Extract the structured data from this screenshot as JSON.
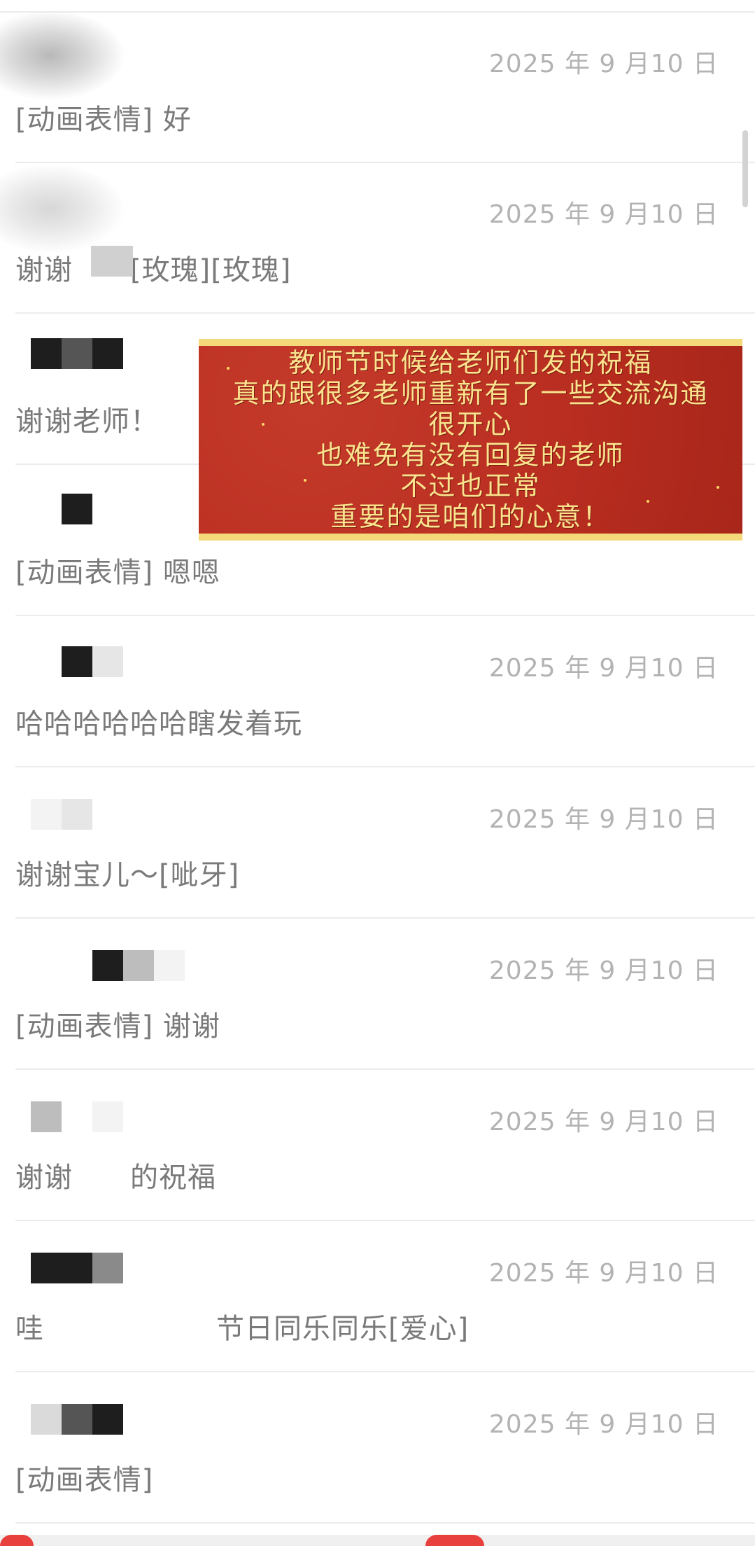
{
  "rows": [
    {
      "date": "2025 年 9 月10 日",
      "message": "[动画表情] 好"
    },
    {
      "date": "2025 年 9 月10 日",
      "message": "谢谢  [玫瑰][玫瑰]"
    },
    {
      "date": "",
      "message": "谢谢老师！"
    },
    {
      "date": "",
      "message": "[动画表情] 嗯嗯"
    },
    {
      "date": "2025 年 9 月10 日",
      "message": "哈哈哈哈哈哈瞎发着玩"
    },
    {
      "date": "2025 年 9 月10 日",
      "message": "谢谢宝儿～[呲牙]"
    },
    {
      "date": "2025 年 9 月10 日",
      "message": "[动画表情] 谢谢"
    },
    {
      "date": "2025 年 9 月10 日",
      "message": "谢谢  的祝福"
    },
    {
      "date": "2025 年 9 月10 日",
      "message": "哇      节日同乐同乐[爱心]"
    },
    {
      "date": "2025 年 9 月10 日",
      "message": "[动画表情]"
    }
  ],
  "banner": {
    "lines": [
      "教师节时候给老师们发的祝福",
      "真的跟很多老师重新有了一些交流沟通",
      "很开心",
      "也难免有没有回复的老师",
      "不过也正常",
      "重要的是咱们的心意！"
    ]
  },
  "colors": {
    "accent": "#e8403c",
    "banner_bg": "#b82d20",
    "banner_text": "#fbe38e",
    "banner_border": "#f4d97a"
  }
}
